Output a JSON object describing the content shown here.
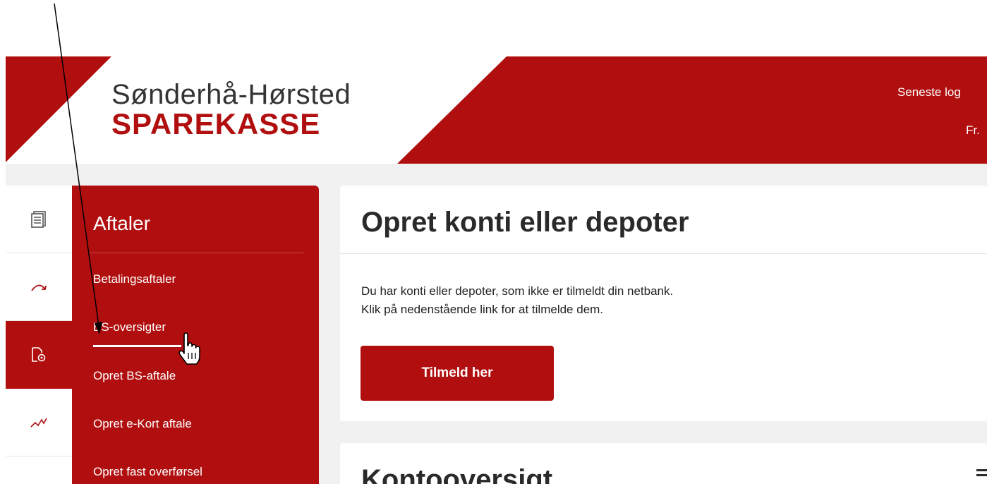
{
  "header": {
    "logo_line1": "Sønderhå-Hørsted",
    "logo_line2": "SPAREKASSE",
    "last_login_label": "Seneste log",
    "last_login_value": "Fr.",
    "brand_color": "#b10f0f"
  },
  "iconbar": {
    "items": [
      {
        "icon": "document-list-icon"
      },
      {
        "icon": "transfer-arrow-icon"
      },
      {
        "icon": "agreement-document-icon",
        "active": true
      },
      {
        "icon": "investment-chart-icon"
      }
    ]
  },
  "submenu": {
    "title": "Aftaler",
    "items": [
      {
        "label": "Betalingsaftaler"
      },
      {
        "label": "BS-oversigter"
      },
      {
        "label": "Opret BS-aftale"
      },
      {
        "label": "Opret e-Kort aftale"
      },
      {
        "label": "Opret fast overførsel"
      }
    ]
  },
  "main": {
    "card1": {
      "title": "Opret konti eller depoter",
      "text_line1": "Du har konti eller depoter, som ikke er tilmeldt din netbank.",
      "text_line2": "Klik på nedenstående link for at tilmelde dem.",
      "button_label": "Tilmeld her"
    },
    "card2": {
      "title": "Kontooversigt"
    }
  }
}
